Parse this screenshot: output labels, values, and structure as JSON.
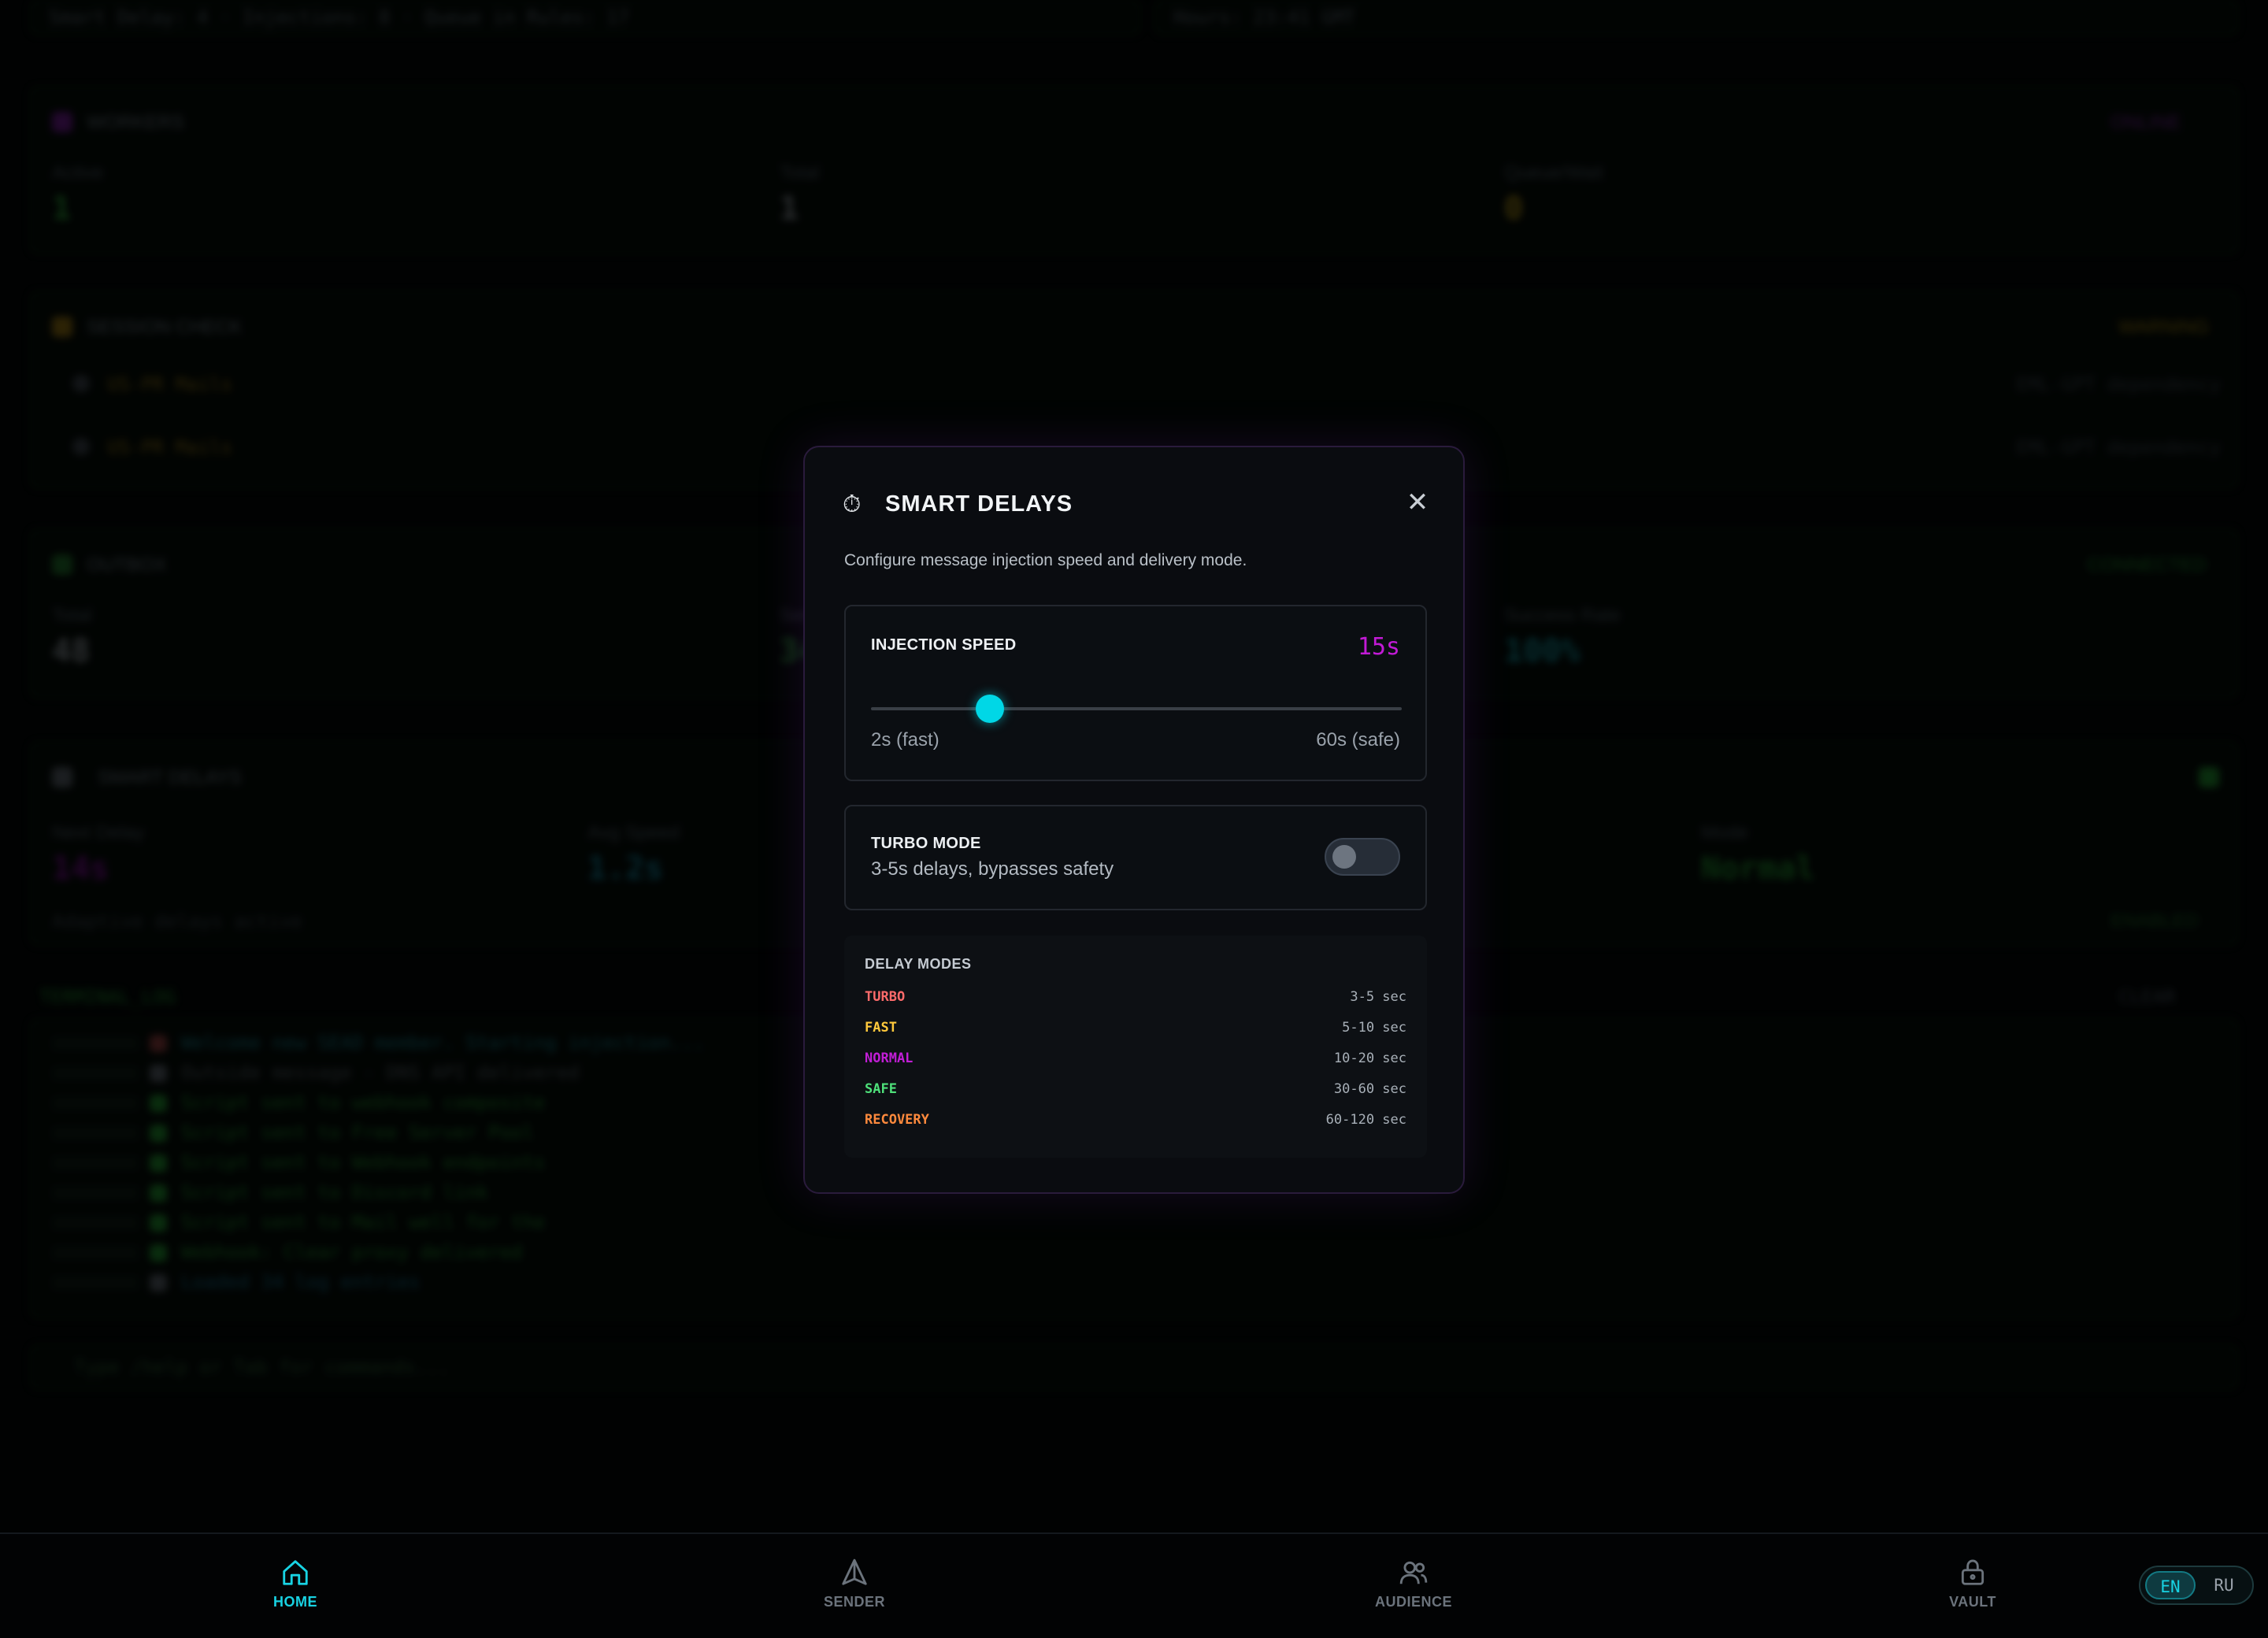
{
  "background": {
    "top_left": "Smart Delay: 4 · Injections: 8 · Queue in Rules: 17",
    "top_right": "Hours: 23:41 GMT",
    "workers": {
      "title": "WORKERS",
      "badge": "ONLINE",
      "stats": [
        {
          "label": "Active",
          "value": "1",
          "color": "#3bd14a"
        },
        {
          "label": "Total",
          "value": "1",
          "color": "#c9ced4"
        },
        {
          "label": "Queue/Wait",
          "value": "0",
          "color": "#e3c21c"
        }
      ]
    },
    "session": {
      "title": "SESSION CHECK",
      "badge": "WARNING",
      "rows": [
        {
          "name": "US-PR Mails",
          "meta": "EML-GPT dependency"
        },
        {
          "name": "US-PR Mails",
          "meta": "EML-GPT dependency"
        }
      ]
    },
    "outbox": {
      "title": "OUTBOX",
      "badge": "CONNECTED",
      "stats": [
        {
          "label": "Total",
          "value": "48",
          "color": "#c9ced4"
        },
        {
          "label": "Sent",
          "value": "34",
          "color": "#3bd14a"
        },
        {
          "label": "Success Rate",
          "value": "100%",
          "color": "#18c0cc"
        }
      ]
    },
    "smart_delays": {
      "title": "SMART DELAYS",
      "stats": [
        {
          "label": "Next Delay",
          "value": "14s",
          "color": "#b517cc"
        },
        {
          "label": "Avg Speed",
          "value": "1.2s",
          "color": "#1aa9c4"
        },
        {
          "label": "Mode",
          "value": "Normal",
          "color": "#2fc046"
        }
      ],
      "footer": "Adaptive delays active",
      "footer_badge": "ENABLED"
    },
    "terminal": {
      "title": "TERMINAL_LOG",
      "right": "CLEAR",
      "lines": [
        "Welcome new SEAD member. Starting injection...",
        "Outside message - DNS API delivered",
        "Script sent to webhook composite",
        "Script sent to Free Server Pool",
        "Script sent to Webhook endpoints",
        "Script sent to Discord link",
        "Script sent to Mail well for the",
        "Webhook: Clear proxy delivered",
        "Loaded 34 log entries"
      ],
      "prompt": "Type /help or Tab for commands..."
    }
  },
  "modal": {
    "icon": "stopwatch-icon",
    "title": "SMART DELAYS",
    "description": "Configure message injection speed and delivery mode.",
    "injection_speed": {
      "label": "INJECTION SPEED",
      "value_text": "15s",
      "value": 15,
      "min": 2,
      "max": 60,
      "min_label": "2s (fast)",
      "max_label": "60s (safe)"
    },
    "turbo": {
      "label": "TURBO MODE",
      "description": "3-5s delays, bypasses safety",
      "enabled": false
    },
    "delay_modes": {
      "title": "DELAY MODES",
      "items": [
        {
          "name": "TURBO",
          "range": "3-5 sec",
          "color": "#ff6b6b"
        },
        {
          "name": "FAST",
          "range": "5-10 sec",
          "color": "#ffc93c"
        },
        {
          "name": "NORMAL",
          "range": "10-20 sec",
          "color": "#c11ed6"
        },
        {
          "name": "SAFE",
          "range": "30-60 sec",
          "color": "#4ee07a"
        },
        {
          "name": "RECOVERY",
          "range": "60-120 sec",
          "color": "#ff8a3d"
        }
      ]
    }
  },
  "nav": {
    "items": [
      {
        "label": "HOME",
        "icon": "home-icon",
        "active": true
      },
      {
        "label": "SENDER",
        "icon": "send-icon",
        "active": false
      },
      {
        "label": "AUDIENCE",
        "icon": "users-icon",
        "active": false
      },
      {
        "label": "VAULT",
        "icon": "lock-icon",
        "active": false
      }
    ],
    "lang": {
      "en": "EN",
      "ru": "RU",
      "active": "EN"
    }
  },
  "colors": {
    "accent": "#00d7e6",
    "speed_value": "#c21ad6",
    "nav_active": "#18d3e3",
    "nav_inactive": "#6b737c"
  }
}
